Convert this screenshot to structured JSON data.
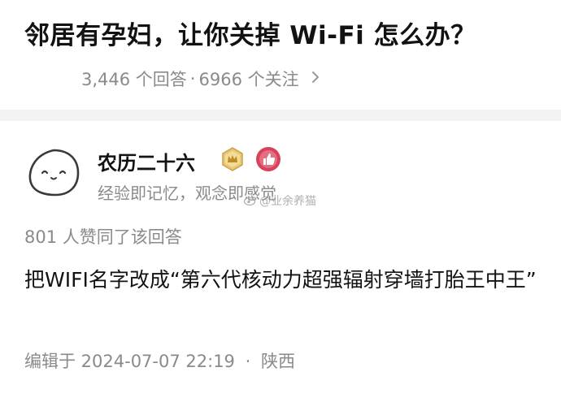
{
  "question": {
    "title": "邻居有孕妇，让你关掉 Wi-Fi 怎么办？",
    "answer_count": "3,446 个回答",
    "separator": "·",
    "follower_count": "6966 个关注",
    "more_icon": "chevron-right-icon"
  },
  "answer": {
    "author": {
      "name": "农历二十六",
      "bio": "经验即记忆，观念即感觉",
      "avatar_icon": "cartoon-face-avatar",
      "badges": [
        {
          "icon": "crown-badge-icon",
          "color": "#c9a24a"
        },
        {
          "icon": "thumbs-up-badge-icon",
          "color": "#d9405a"
        }
      ]
    },
    "watermark": "@业余养猫",
    "likes": "801 人赞同了该回答",
    "content": "把WIFI名字改成“第六代核动力超强辐射穿墙打胎王中王”",
    "edited": "编辑于 2024-07-07 22:19",
    "dot": "·",
    "location": "陕西"
  }
}
